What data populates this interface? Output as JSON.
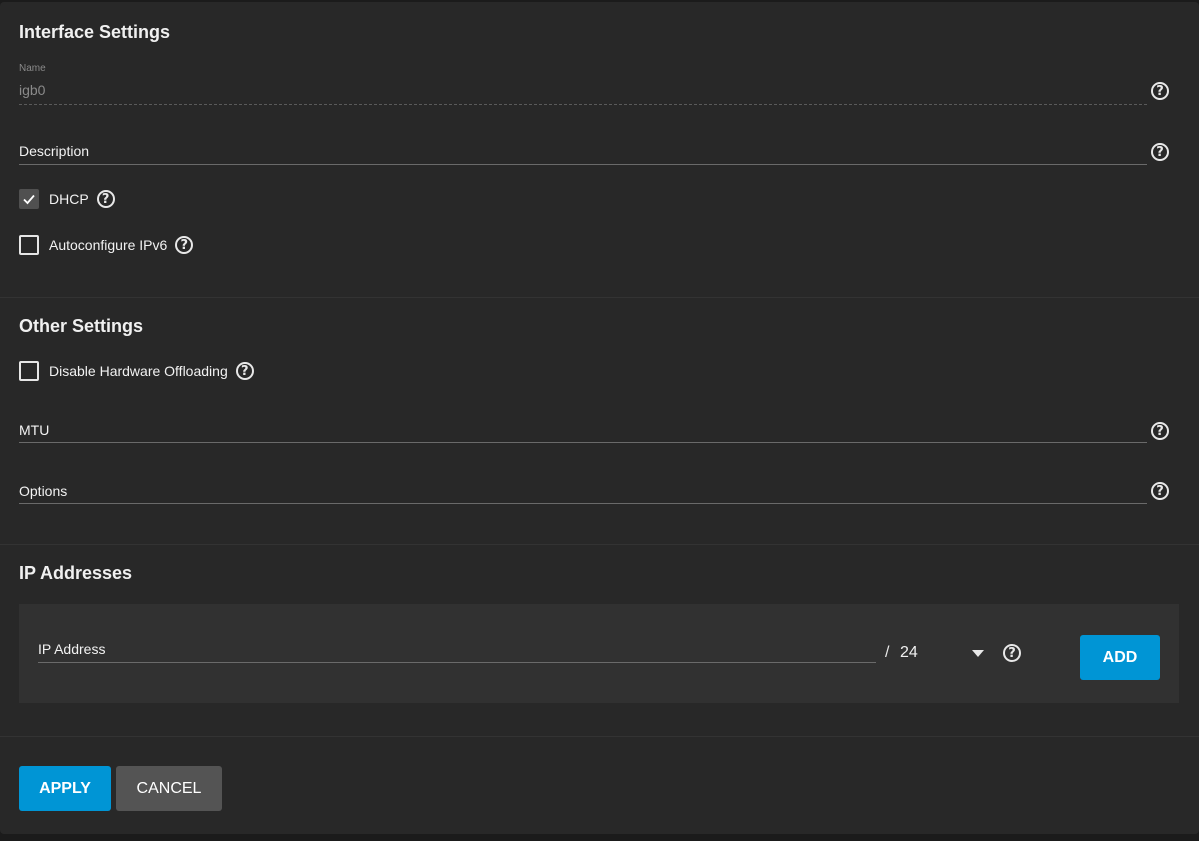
{
  "interface_settings": {
    "title": "Interface Settings",
    "name_label": "Name",
    "name_value": "igb0",
    "description_label": "Description",
    "dhcp_label": "DHCP",
    "dhcp_checked": true,
    "autoconf_label": "Autoconfigure IPv6",
    "autoconf_checked": false
  },
  "other_settings": {
    "title": "Other Settings",
    "disable_offload_label": "Disable Hardware Offloading",
    "disable_offload_checked": false,
    "mtu_label": "MTU",
    "options_label": "Options"
  },
  "ip_addresses": {
    "title": "IP Addresses",
    "ip_label": "IP Address",
    "slash": "/",
    "netmask_value": "24",
    "add_label": "ADD"
  },
  "actions": {
    "apply_label": "APPLY",
    "cancel_label": "CANCEL"
  },
  "icons": {
    "help": "help-circle-icon",
    "check": "checkmark-icon",
    "dropdown": "caret-down-icon"
  },
  "colors": {
    "accent": "#0095d5",
    "panel_bg": "#282828",
    "secondary_button": "#545454"
  }
}
